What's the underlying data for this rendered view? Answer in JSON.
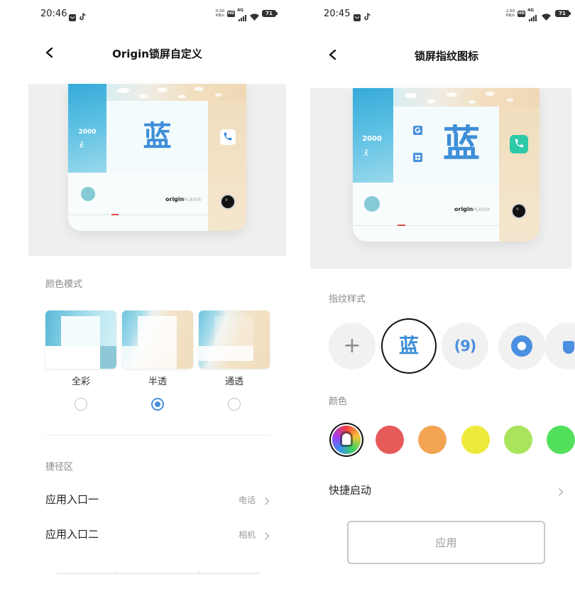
{
  "left_screen": {
    "status_bar": {
      "time": "20:46",
      "speed_value": "0.00",
      "speed_unit": "KB/s",
      "hd": "HD",
      "network": "4G",
      "battery": "71"
    },
    "header": {
      "back_icon": "back-arrow-icon",
      "title": "Origin锁屏自定义"
    },
    "preview": {
      "steps": "2000",
      "big_char": "蓝",
      "brand": "origin",
      "brand_sub": "PLAYER",
      "shortcut_icon": "phone-icon",
      "camera_icon": "camera-icon"
    },
    "color_mode": {
      "label": "颜色模式",
      "options": [
        {
          "label": "全彩",
          "selected": false
        },
        {
          "label": "半透",
          "selected": true
        },
        {
          "label": "通透",
          "selected": false
        }
      ]
    },
    "shortcut_area": {
      "label": "捷径区",
      "items": [
        {
          "label": "应用入口一",
          "value": "电话"
        },
        {
          "label": "应用入口二",
          "value": "相机"
        }
      ]
    }
  },
  "right_screen": {
    "status_bar": {
      "time": "20:45",
      "speed_value": "2.60",
      "speed_unit": "KB/s",
      "hd": "HD",
      "network": "4G",
      "battery": "71"
    },
    "header": {
      "back_icon": "back-arrow-icon",
      "title": "锁屏指纹图标"
    },
    "preview": {
      "steps": "2000",
      "big_char": "蓝",
      "brand": "origin",
      "brand_sub": "PLAYER",
      "shortcut_icon": "phone-icon",
      "camera_icon": "camera-icon"
    },
    "fingerprint_style": {
      "label": "指纹样式",
      "options": [
        {
          "glyph": "+",
          "icon": "add-icon",
          "selected": false
        },
        {
          "glyph": "蓝",
          "selected": true
        },
        {
          "glyph": "(9)",
          "selected": false
        },
        {
          "icon": "blue-ring-icon",
          "selected": false
        },
        {
          "icon": "partial-style-icon",
          "selected": false
        }
      ]
    },
    "color": {
      "label": "颜色",
      "swatches": [
        {
          "color": [
            "#f23c3c",
            "#f5c33b",
            "#3cd45a",
            "#3b8ff0",
            "#a23cf0",
            "#f23c3c"
          ],
          "icon": "pen-icon",
          "selected": true
        },
        {
          "color": "#e65a5a",
          "selected": false
        },
        {
          "color": "#f2a453",
          "selected": false
        },
        {
          "color": "#eeea3c",
          "selected": false
        },
        {
          "color": "#a9e45c",
          "selected": false
        },
        {
          "color": "#52e05c",
          "selected": false
        }
      ]
    },
    "quick_launch": {
      "label": "快捷启动"
    },
    "apply_button": {
      "label": "应用"
    }
  },
  "theme": {
    "accent": "#4a8fdf",
    "preview_bg": "#efefef",
    "text_secondary": "#8a8a8a"
  }
}
